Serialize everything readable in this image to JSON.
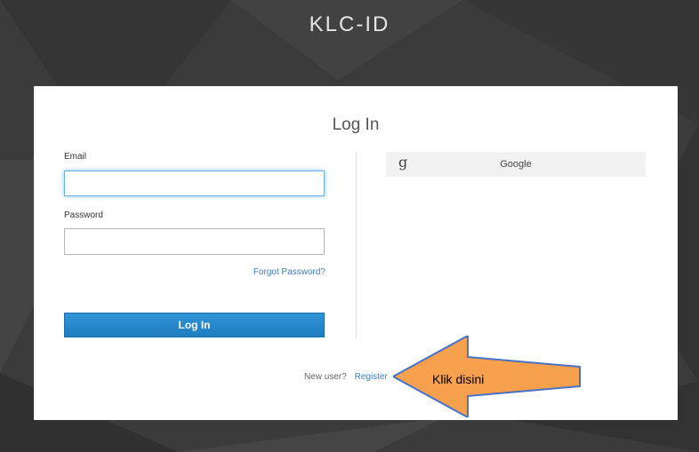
{
  "header": {
    "brand": "KLC-ID"
  },
  "login": {
    "title": "Log In",
    "email_label": "Email",
    "email_value": "",
    "password_label": "Password",
    "password_value": "",
    "forgot_label": "Forgot Password?",
    "login_button": "Log In",
    "google_icon": "g",
    "google_label": "Google",
    "new_user_text": "New user?",
    "register_label": "Register"
  },
  "annotation": {
    "callout_text": "Klik disini",
    "callout_color": "#f7a14f"
  },
  "colors": {
    "accent": "#1f7cc0",
    "link": "#3b7fc4",
    "background": "#3a3a3a"
  }
}
